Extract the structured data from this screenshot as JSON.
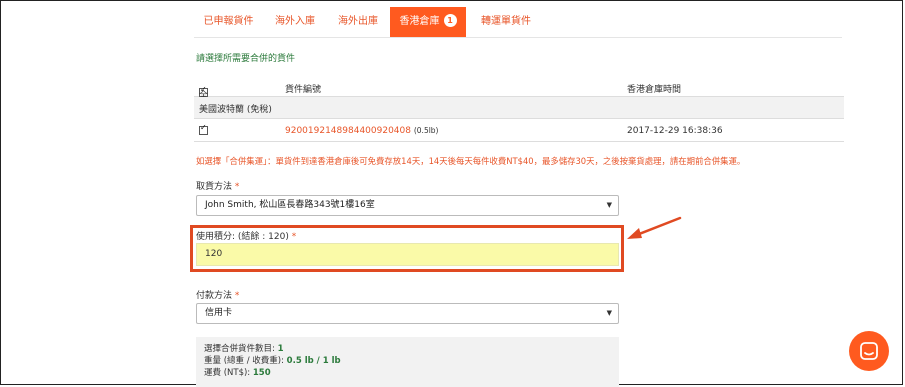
{
  "tabs": [
    {
      "label": "已申報貨件"
    },
    {
      "label": "海外入庫"
    },
    {
      "label": "海外出庫"
    },
    {
      "label": "香港倉庫",
      "badge": "1"
    },
    {
      "label": "轉運單貨件"
    }
  ],
  "section_title": "請選擇所需要合併的貨件",
  "table": {
    "select_all": "全選",
    "col_tracking": "貨件編號",
    "col_time": "香港倉庫時間",
    "group": "美國波特蘭 (免稅)",
    "rows": [
      {
        "tracking": "9200192148984400920408",
        "weight": "(0.5lb)",
        "time": "2017-12-29 16:38:36"
      }
    ]
  },
  "notice": "如選擇「合併集運」：單貨件到達香港倉庫後可免費存放14天，14天後每天每件收費NT$40，最多儲存30天，之後按棄貨處理，請在期前合併集運。",
  "pickup": {
    "label": "取貨方法",
    "required": "*",
    "value": "John Smith, 松山區長春路343號1樓16室"
  },
  "points": {
    "label": "使用積分: (結餘 : 120)",
    "required": "*",
    "value": "120"
  },
  "payment": {
    "label": "付款方法",
    "required": "*",
    "value": "信用卡"
  },
  "summary": {
    "count_label": "選擇合併貨件數目: ",
    "count_value": "1",
    "weight_label": "重量 (總重 / 收費重): ",
    "weight_value": "0.5 lb / 1 lb",
    "fee_label": "運費 (NT$): ",
    "fee_value": "150"
  },
  "colors": {
    "accent": "#ff5a1f",
    "highlight_border": "#e04a22",
    "green": "#2b7a3b",
    "input_bg": "#fafaa8"
  }
}
